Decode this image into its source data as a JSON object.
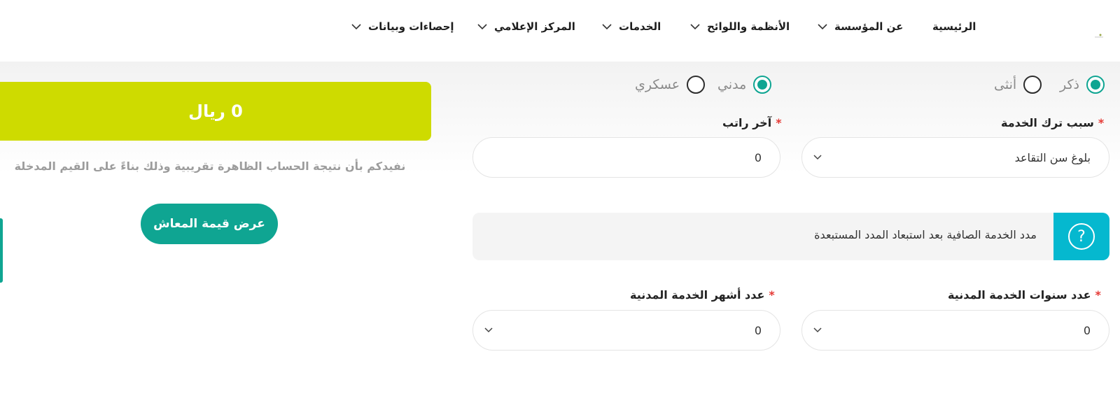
{
  "nav": {
    "items": [
      {
        "label": "الرئيسية",
        "has_dropdown": false
      },
      {
        "label": "عن المؤسسة",
        "has_dropdown": true
      },
      {
        "label": "الأنظمة واللوائح",
        "has_dropdown": true
      },
      {
        "label": "الخدمات",
        "has_dropdown": true
      },
      {
        "label": "المركز الإعلامي",
        "has_dropdown": true
      },
      {
        "label": "إحصاءات وبيانات",
        "has_dropdown": true
      }
    ]
  },
  "form": {
    "gender": {
      "options": [
        "ذكر",
        "أنثى"
      ],
      "selected": "ذكر"
    },
    "sector": {
      "options": [
        "مدني",
        "عسكري"
      ],
      "selected": "مدني"
    },
    "leave_reason": {
      "label": "سبب ترك الخدمة",
      "required_mark": "*",
      "value": "بلوغ سن التقاعد"
    },
    "last_salary": {
      "label": "آخر راتب",
      "required_mark": "*",
      "value": "0"
    },
    "info_note": "مدد الخدمة الصافية بعد استبعاد المدد المستبعدة",
    "service_years": {
      "label": "عدد سنوات الخدمة المدنية",
      "required_mark": "*",
      "value": "0"
    },
    "service_months": {
      "label": "عدد أشهر الخدمة المدنية",
      "required_mark": "*",
      "value": "0"
    }
  },
  "result": {
    "amount": "0 ريال",
    "note": "نفيدكم بأن نتيجة الحساب الظاهرة تقريبية وذلك بناءً على القيم المدخلة",
    "button_label": "عرض قيمة المعاش"
  },
  "colors": {
    "accent": "#0fa592",
    "result_bg": "#cedb00",
    "info_icon_bg": "#05b8cf",
    "required": "#e53935"
  },
  "icons": [
    "chevron-down-icon",
    "question-icon",
    "radio-checked-icon",
    "radio-unchecked-icon"
  ]
}
